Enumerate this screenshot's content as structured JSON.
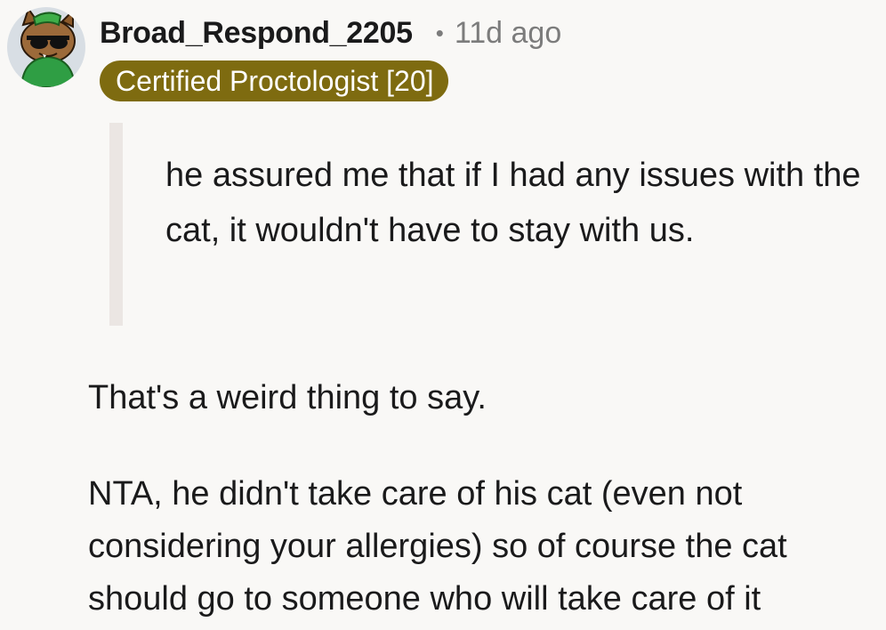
{
  "comment": {
    "username": "Broad_Respond_2205",
    "separator": "•",
    "age": "11d ago",
    "flair": "Certified Proctologist [20]",
    "flair_color": "#7e6b10",
    "avatar_icon": "snoo-avatar-icon",
    "quote": "he assured me that if I had any issues with the cat, it wouldn't have to stay with us.",
    "paragraphs": [
      "That's a weird thing to say.",
      "NTA, he didn't take care of his cat (even not considering your allergies) so of course the cat should go to someone who will take care of it"
    ]
  }
}
